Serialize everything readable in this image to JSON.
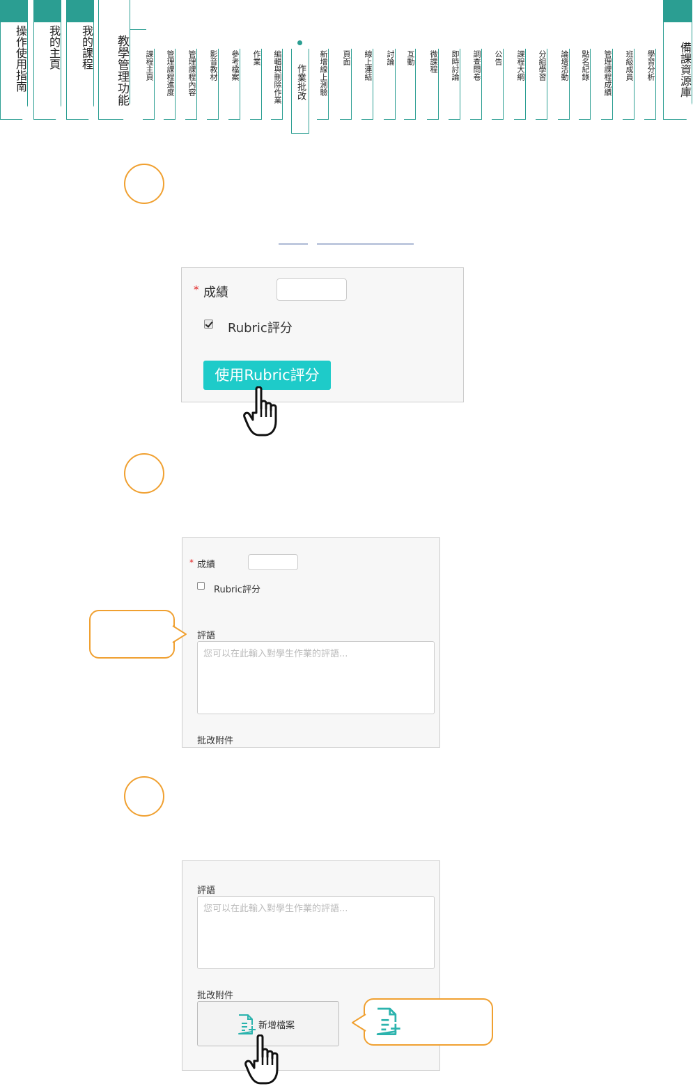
{
  "nav": {
    "main_tabs": [
      "操作使用指南",
      "我的主頁",
      "我的課程"
    ],
    "group_tab": "教學管理功能",
    "sub_items": [
      "課程主頁",
      "管理課程進度",
      "管理課程內容",
      "影音教材",
      "參考檔案",
      "作業",
      "編輯與刪除作業",
      "作業批改",
      "新增線上測驗",
      "頁面",
      "線上連結",
      "討論",
      "互動",
      "微課程",
      "即時討論",
      "調查問卷",
      "公告",
      "課程大綱",
      "分組學習",
      "論壇活動",
      "點名紀錄",
      "管理課程成績",
      "班級成員",
      "學習分析"
    ],
    "active_item": "作業批改",
    "right_tab": "備課資源庫"
  },
  "panel1": {
    "score_label": "成績",
    "required_mark": "*",
    "rubric_checkbox_label": "Rubric評分",
    "rubric_checked": true,
    "rubric_button": "使用Rubric評分"
  },
  "panel2": {
    "score_label": "成績",
    "required_mark": "*",
    "rubric_checkbox_label": "Rubric評分",
    "rubric_checked": false,
    "comment_label": "評語",
    "comment_placeholder": "您可以在此輸入對學生作業的評語...",
    "attachment_label": "批改附件"
  },
  "panel3": {
    "comment_label": "評語",
    "comment_placeholder": "您可以在此輸入對學生作業的評語...",
    "attachment_label": "批改附件",
    "add_file_button": "新增檔案"
  },
  "colors": {
    "accent": "#2b9e92",
    "button": "#1ecbc9",
    "callout": "#f0a030"
  },
  "icons": [
    "hand-pointer-icon",
    "add-file-icon"
  ]
}
